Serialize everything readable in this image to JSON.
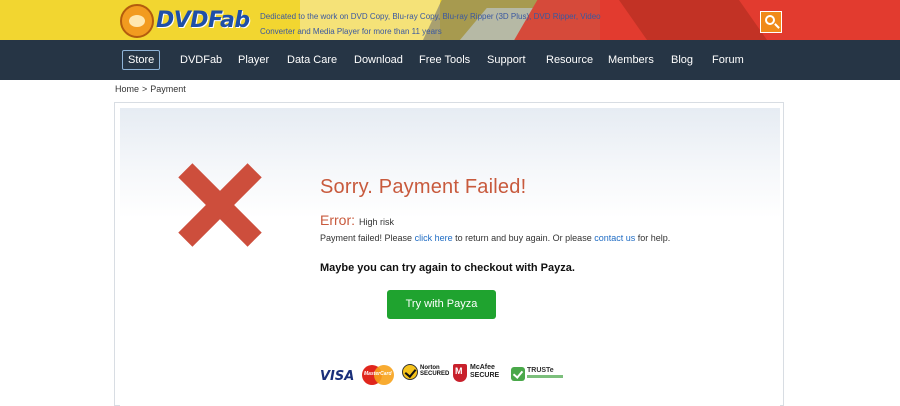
{
  "header": {
    "logo_text": "DVDFab",
    "tagline": "Dedicated to the work on DVD Copy, Blu-ray Copy, Blu-ray Ripper (3D Plus), DVD Ripper, Video Converter and Media Player for more than 11 years",
    "search_icon": "search-icon"
  },
  "nav": {
    "items": [
      {
        "label": "Store",
        "active": true
      },
      {
        "label": "DVDFab"
      },
      {
        "label": "Player"
      },
      {
        "label": "Data Care"
      },
      {
        "label": "Download"
      },
      {
        "label": "Free Tools"
      },
      {
        "label": "Support"
      },
      {
        "label": "Resource"
      },
      {
        "label": "Members"
      },
      {
        "label": "Blog"
      },
      {
        "label": "Forum"
      }
    ]
  },
  "breadcrumb": {
    "home": "Home",
    "separator": ">",
    "current": "Payment"
  },
  "main": {
    "icon": "error-x-icon",
    "title": "Sorry. Payment Failed!",
    "error_label": "Error:",
    "error_detail": "High risk",
    "message_prefix": "Payment failed! Please",
    "click_here": "click here",
    "message_middle": "to return and buy again. Or please",
    "contact_us": "contact us",
    "message_suffix": "for help.",
    "retry_text": "Maybe you can try again to checkout with Payza.",
    "payza_button": "Try with Payza"
  },
  "badges": {
    "visa": "VISA",
    "mastercard": "MasterCard",
    "norton": "Norton SECURED",
    "mcafee": "McAfee SECURE",
    "truste": "TRUSTe"
  },
  "colors": {
    "nav_bg": "#263545",
    "error_red": "#c85a3d",
    "payza_green": "#1fa32f",
    "link_blue": "#1f6cc4"
  }
}
